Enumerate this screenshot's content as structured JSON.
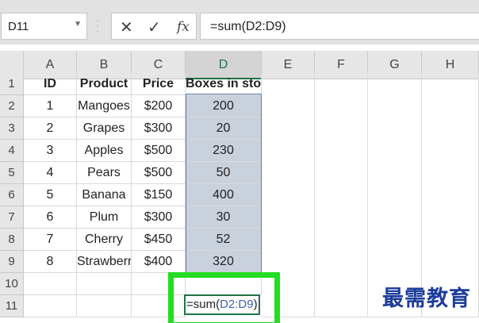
{
  "formula_bar": {
    "name_box": "D11",
    "cancel_icon": "✕",
    "enter_icon": "✓",
    "fx_label": "fx",
    "formula": "=sum(D2:D9)"
  },
  "columns": [
    "A",
    "B",
    "C",
    "D",
    "E",
    "F",
    "G",
    "H"
  ],
  "selected_column": "D",
  "row_numbers": [
    "1",
    "2",
    "3",
    "4",
    "5",
    "6",
    "7",
    "8",
    "9",
    "10",
    "11"
  ],
  "table": {
    "headers": [
      "ID",
      "Product",
      "Price",
      "Boxes in stock"
    ],
    "rows": [
      [
        "1",
        "Mangoes",
        "$200",
        "200"
      ],
      [
        "2",
        "Grapes",
        "$300",
        "20"
      ],
      [
        "3",
        "Apples",
        "$500",
        "230"
      ],
      [
        "4",
        "Pears",
        "$500",
        "50"
      ],
      [
        "5",
        "Banana",
        "$150",
        "400"
      ],
      [
        "6",
        "Plum",
        "$300",
        "30"
      ],
      [
        "7",
        "Cherry",
        "$450",
        "52"
      ],
      [
        "8",
        "Strawberry",
        "$400",
        "320"
      ]
    ]
  },
  "active_cell": {
    "text_prefix": "=sum(",
    "range_ref": "D2:D9",
    "text_suffix": ")"
  },
  "watermark": "最需教育",
  "colors": {
    "highlight_fill": "#c9d1dc",
    "highlight_callout": "#22dd22",
    "range_reference": "#3a64b8"
  }
}
